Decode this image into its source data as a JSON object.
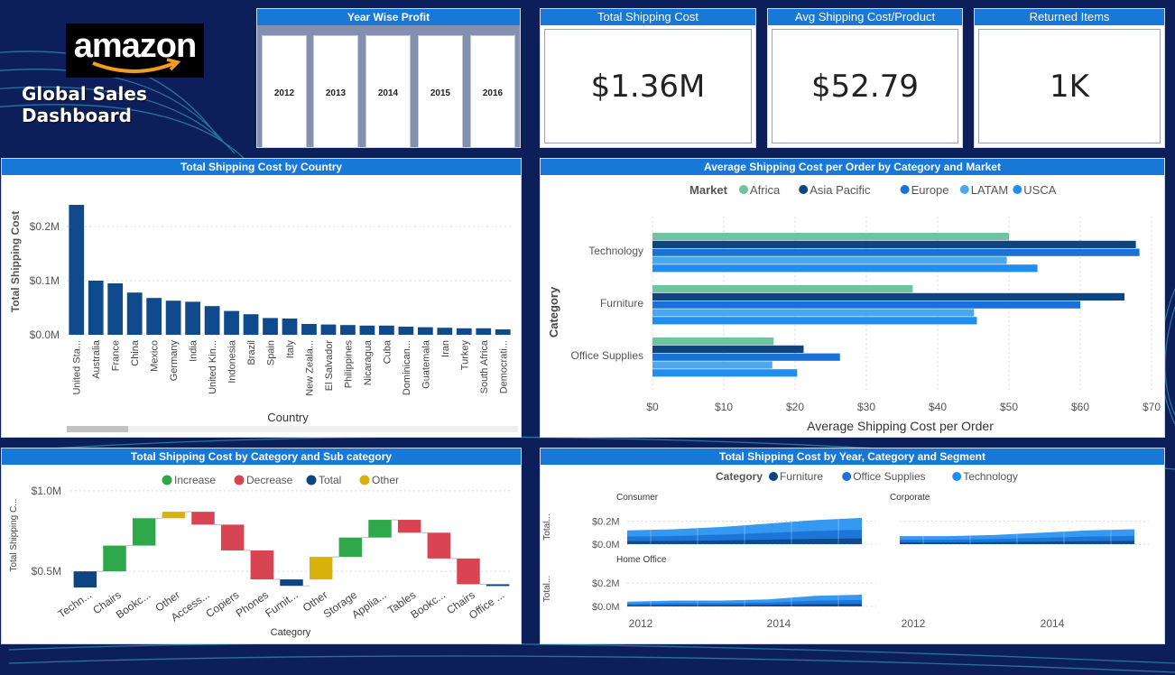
{
  "header": {
    "logo_text": "amazon",
    "dashboard_title": "Global Sales Dashboard"
  },
  "year_slicer": {
    "title": "Year Wise Profit",
    "years": [
      "2012",
      "2013",
      "2014",
      "2015",
      "2016"
    ]
  },
  "kpis": [
    {
      "title": "Total Shipping Cost",
      "value": "$1.36M"
    },
    {
      "title": "Avg Shipping Cost/Product",
      "value": "$52.79"
    },
    {
      "title": "Returned Items",
      "value": "1K"
    }
  ],
  "colors": {
    "accent": "#1878d8",
    "background": "#0d1f5a",
    "bar": "#0e4a8c",
    "africa": "#6cc4a0",
    "asia_pacific": "#0e4480",
    "europe": "#1a72d6",
    "latam": "#4aa8f0",
    "usca": "#1f8ef0",
    "increase": "#2ea84a",
    "decrease": "#d94452",
    "total": "#0e4480",
    "other": "#d8b20a"
  },
  "chart_data": [
    {
      "type": "bar",
      "title": "Total Shipping Cost by Country",
      "xlabel": "Country",
      "ylabel": "Total Shipping Cost",
      "ylim": [
        0,
        0.27
      ],
      "yticks": [
        "$0.0M",
        "$0.1M",
        "$0.2M"
      ],
      "ytick_values": [
        0,
        0.1,
        0.2
      ],
      "categories": [
        "United Sta...",
        "Australia",
        "France",
        "China",
        "Mexico",
        "Germany",
        "India",
        "United Kin...",
        "Indonesia",
        "Brazil",
        "Spain",
        "Italy",
        "New Zeala...",
        "El Salvador",
        "Philippines",
        "Nicaragua",
        "Cuba",
        "Dominican...",
        "Guatemala",
        "Iran",
        "Turkey",
        "South Africa",
        "Democrati..."
      ],
      "values": [
        0.24,
        0.1,
        0.095,
        0.078,
        0.068,
        0.063,
        0.061,
        0.053,
        0.044,
        0.038,
        0.031,
        0.03,
        0.02,
        0.019,
        0.018,
        0.017,
        0.017,
        0.015,
        0.014,
        0.013,
        0.012,
        0.012,
        0.01
      ]
    },
    {
      "type": "bar",
      "orientation": "horizontal",
      "title": "Average Shipping Cost per Order by Category and Market",
      "xlabel": "Average Shipping Cost per Order",
      "ylabel": "Category",
      "legend_title": "Market",
      "xlim": [
        0,
        70
      ],
      "xticks": [
        "$0",
        "$10",
        "$20",
        "$30",
        "$40",
        "$50",
        "$60",
        "$70"
      ],
      "categories": [
        "Technology",
        "Furniture",
        "Office Supplies"
      ],
      "series": [
        {
          "name": "Africa",
          "values": [
            50.0,
            36.5,
            17.0
          ]
        },
        {
          "name": "Asia Pacific",
          "values": [
            67.8,
            66.2,
            21.2
          ]
        },
        {
          "name": "Europe",
          "values": [
            68.3,
            60.0,
            26.3
          ]
        },
        {
          "name": "LATAM",
          "values": [
            49.7,
            45.1,
            16.8
          ]
        },
        {
          "name": "USCA",
          "values": [
            54.0,
            45.5,
            20.3
          ]
        }
      ]
    },
    {
      "type": "waterfall",
      "title": "Total Shipping Cost by Category and Sub category",
      "xlabel": "Category",
      "ylabel": "Total Shipping C...",
      "ylim": [
        0.4,
        1.05
      ],
      "yticks": [
        "$0.5M",
        "$1.0M"
      ],
      "ytick_values": [
        0.5,
        1.0
      ],
      "legend": [
        "Increase",
        "Decrease",
        "Total",
        "Other"
      ],
      "steps": [
        {
          "label": "Techn...",
          "kind": "total",
          "start": 0.4,
          "end": 0.5
        },
        {
          "label": "Chairs",
          "kind": "increase",
          "start": 0.5,
          "end": 0.66
        },
        {
          "label": "Bookc...",
          "kind": "increase",
          "start": 0.66,
          "end": 0.83
        },
        {
          "label": "Other",
          "kind": "other",
          "start": 0.83,
          "end": 0.87
        },
        {
          "label": "Access...",
          "kind": "decrease",
          "start": 0.87,
          "end": 0.79
        },
        {
          "label": "Copiers",
          "kind": "decrease",
          "start": 0.79,
          "end": 0.63
        },
        {
          "label": "Phones",
          "kind": "decrease",
          "start": 0.63,
          "end": 0.45
        },
        {
          "label": "Furnit...",
          "kind": "total",
          "start": 0.45,
          "end": 0.41
        },
        {
          "label": "Other",
          "kind": "other",
          "start": 0.45,
          "end": 0.59
        },
        {
          "label": "Storage",
          "kind": "increase",
          "start": 0.59,
          "end": 0.71
        },
        {
          "label": "Applia...",
          "kind": "increase",
          "start": 0.71,
          "end": 0.82
        },
        {
          "label": "Tables",
          "kind": "decrease",
          "start": 0.82,
          "end": 0.74
        },
        {
          "label": "Bookc...",
          "kind": "decrease",
          "start": 0.74,
          "end": 0.58
        },
        {
          "label": "Chairs",
          "kind": "decrease",
          "start": 0.58,
          "end": 0.42
        },
        {
          "label": "Office ...",
          "kind": "total",
          "start": 0.42,
          "end": 0.41
        }
      ]
    },
    {
      "type": "area",
      "title": "Total Shipping Cost by Year, Category and Segment",
      "legend_title": "Category",
      "legend": [
        "Furniture",
        "Office Supplies",
        "Technology"
      ],
      "ylabel": "Total...",
      "yticks": [
        "$0.0M",
        "$0.2M"
      ],
      "xticks": [
        "2012",
        "2014"
      ],
      "panels": [
        {
          "name": "Consumer",
          "values": [
            0.12,
            0.13,
            0.15,
            0.18,
            0.21,
            0.23
          ]
        },
        {
          "name": "Corporate",
          "values": [
            0.07,
            0.07,
            0.08,
            0.1,
            0.12,
            0.13
          ]
        },
        {
          "name": "Home Office",
          "values": [
            0.04,
            0.05,
            0.05,
            0.06,
            0.09,
            0.1
          ]
        }
      ]
    }
  ]
}
